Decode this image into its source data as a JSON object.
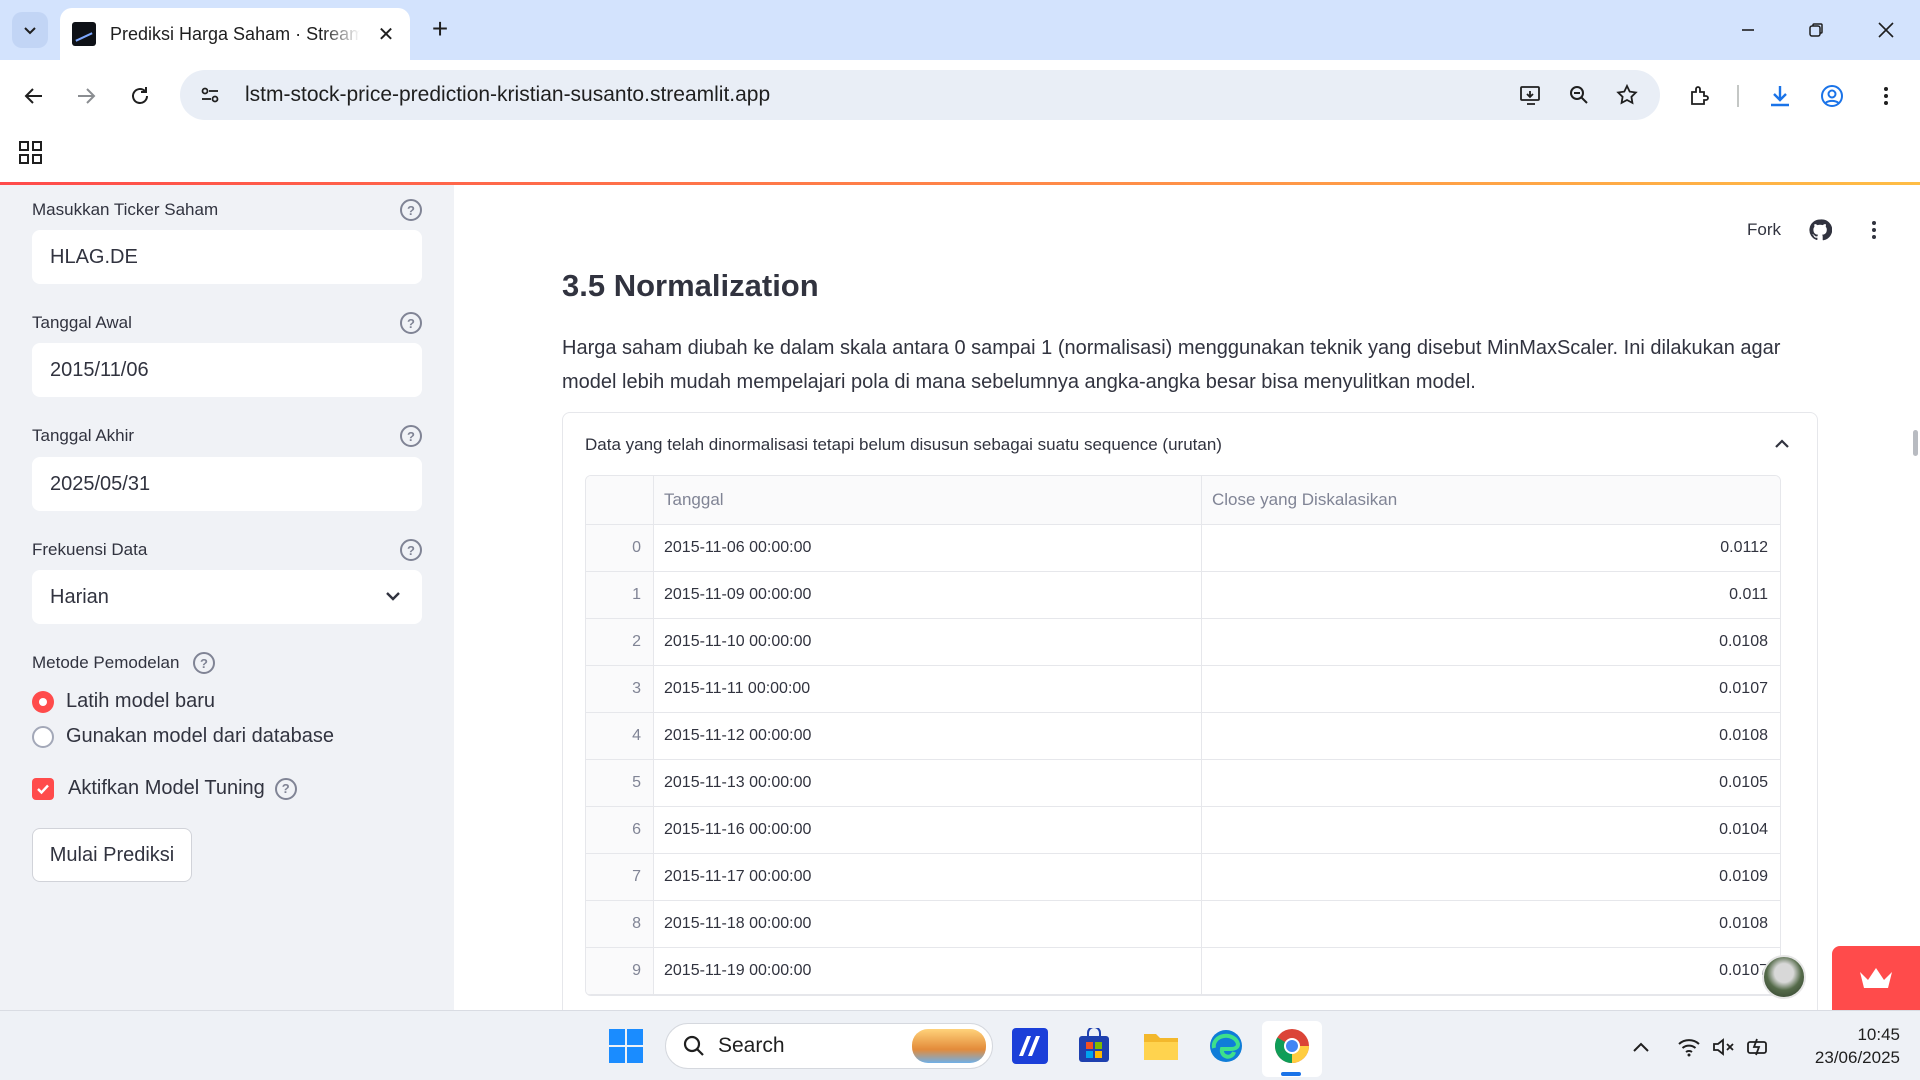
{
  "browser": {
    "tab_title": "Prediksi Harga Saham · Streamlit",
    "url": "lstm-stock-price-prediction-kristian-susanto.streamlit.app"
  },
  "sidebar": {
    "ticker": {
      "label": "Masukkan Ticker Saham",
      "value": "HLAG.DE"
    },
    "start_date": {
      "label": "Tanggal Awal",
      "value": "2015/11/06"
    },
    "end_date": {
      "label": "Tanggal Akhir",
      "value": "2025/05/31"
    },
    "frequency": {
      "label": "Frekuensi Data",
      "value": "Harian"
    },
    "method": {
      "label": "Metode Pemodelan",
      "options": [
        "Latih model baru",
        "Gunakan model dari database"
      ],
      "selected": "Latih model baru"
    },
    "tuning": {
      "label": "Aktifkan Model Tuning",
      "checked": true
    },
    "predict_button": "Mulai Prediksi"
  },
  "header": {
    "fork": "Fork"
  },
  "main": {
    "heading": "3.5 Normalization",
    "paragraph": "Harga saham diubah ke dalam skala antara 0 sampai 1 (normalisasi) menggunakan teknik yang disebut MinMaxScaler. Ini dilakukan agar model lebih mudah mempelajari pola di mana sebelumnya angka-angka besar bisa menyulitkan model.",
    "expander_title": "Data yang telah dinormalisasi tetapi belum disusun sebagai suatu sequence (urutan)",
    "table": {
      "columns": [
        "Tanggal",
        "Close yang Diskalasikan"
      ],
      "rows": [
        {
          "index": "0",
          "date": "2015-11-06 00:00:00",
          "value": "0.0112"
        },
        {
          "index": "1",
          "date": "2015-11-09 00:00:00",
          "value": "0.011"
        },
        {
          "index": "2",
          "date": "2015-11-10 00:00:00",
          "value": "0.0108"
        },
        {
          "index": "3",
          "date": "2015-11-11 00:00:00",
          "value": "0.0107"
        },
        {
          "index": "4",
          "date": "2015-11-12 00:00:00",
          "value": "0.0108"
        },
        {
          "index": "5",
          "date": "2015-11-13 00:00:00",
          "value": "0.0105"
        },
        {
          "index": "6",
          "date": "2015-11-16 00:00:00",
          "value": "0.0104"
        },
        {
          "index": "7",
          "date": "2015-11-17 00:00:00",
          "value": "0.0109"
        },
        {
          "index": "8",
          "date": "2015-11-18 00:00:00",
          "value": "0.0108"
        },
        {
          "index": "9",
          "date": "2015-11-19 00:00:00",
          "value": "0.0107"
        }
      ]
    }
  },
  "taskbar": {
    "search_placeholder": "Search",
    "time": "10:45",
    "date": "23/06/2025"
  },
  "colors": {
    "accent": "#ff4b4b",
    "sidebar_bg": "#f0f2f6",
    "chrome_tabstrip": "#d3e3fd"
  }
}
